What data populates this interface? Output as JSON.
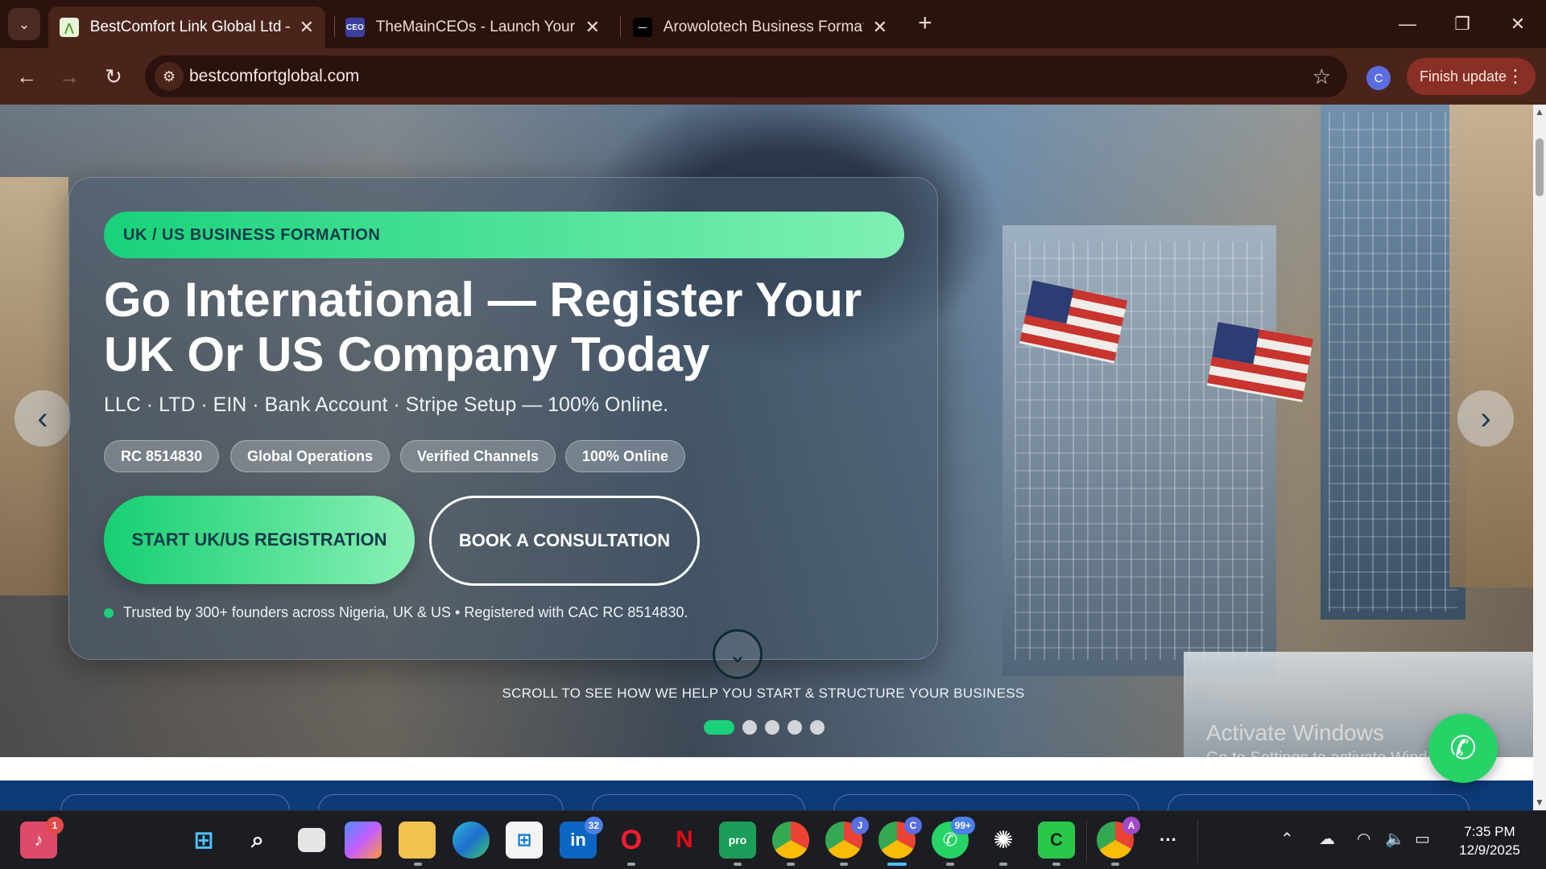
{
  "browser": {
    "tabs": [
      {
        "title": "BestComfort Link Global Ltd – R",
        "favicon": "bestcomfort-logo",
        "active": true
      },
      {
        "title": "TheMainCEOs - Launch Your Bu",
        "favicon": "themainceos-logo",
        "active": false
      },
      {
        "title": "Arowolotech Business Formatio",
        "favicon": "arowolotech-logo",
        "active": false
      }
    ],
    "url": "bestcomfortglobal.com",
    "profile_initial": "C",
    "finish_update_label": "Finish update"
  },
  "hero": {
    "eyebrow": "UK / US BUSINESS FORMATION",
    "headline_line1": "Go International — Register Your",
    "headline_line2": "UK Or US Company Today",
    "subline": "LLC · LTD · EIN · Bank Account · Stripe Setup — 100% Online.",
    "chips": [
      "RC 8514830",
      "Global Operations",
      "Verified Channels",
      "100% Online"
    ],
    "cta_primary": "START UK/US REGISTRATION",
    "cta_secondary": "BOOK A CONSULTATION",
    "trust_text": "Trusted by 300+ founders across Nigeria, UK & US • Registered with CAC RC 8514830.",
    "scroll_hint": "SCROLL TO SEE HOW WE HELP YOU START & STRUCTURE YOUR BUSINESS",
    "slides_total": 5,
    "slide_active": 1,
    "accent_color": "#19d27a"
  },
  "watermark": {
    "line1": "Activate Windows",
    "line2": "Go to Settings to activate Windows."
  },
  "taskbar": {
    "badges": {
      "notifications": "1",
      "linkedin": "32",
      "whatsapp": "99+"
    },
    "profile_badges": {
      "chrome_j": "J",
      "chrome_c": "C",
      "chrome_a": "A"
    },
    "time": "7:35 PM",
    "date": "12/9/2025"
  }
}
